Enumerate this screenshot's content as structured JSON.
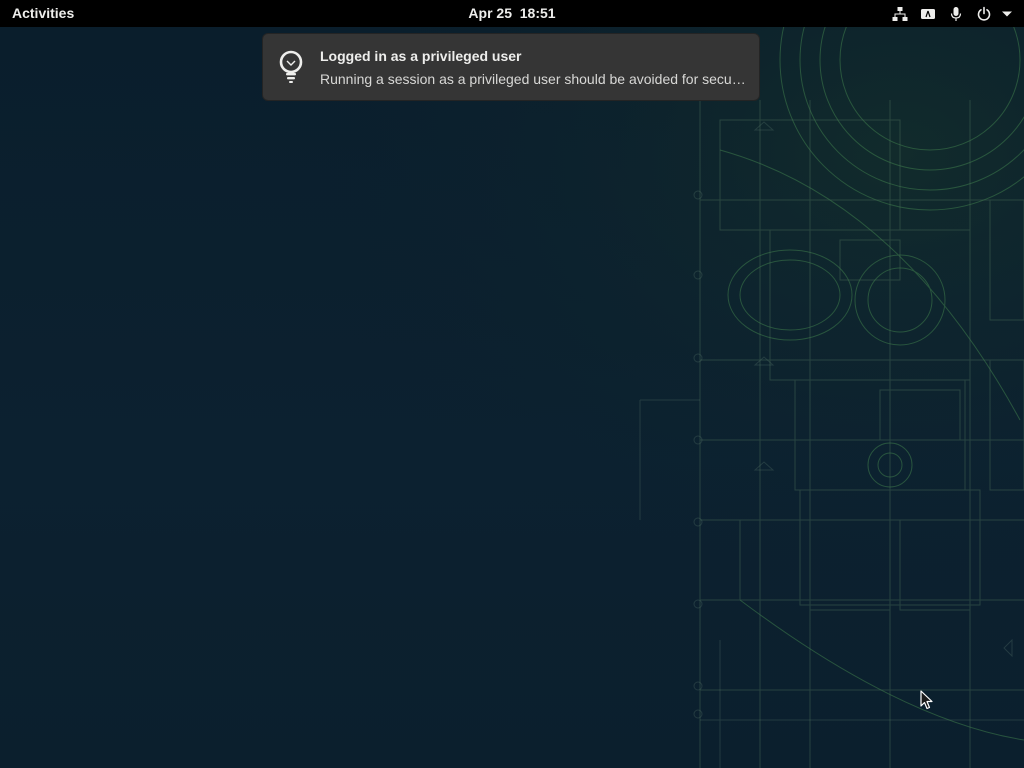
{
  "topbar": {
    "activities_label": "Activities",
    "clock": "Apr 25  18:51",
    "tray_icons": [
      "network-icon",
      "keyboard-layout-icon",
      "microphone-icon",
      "power-icon",
      "chevron-down-icon"
    ]
  },
  "notification": {
    "icon": "lightbulb-icon",
    "title": "Logged in as a privileged user",
    "body": "Running a session as a privileged user should be avoided for security reasons."
  },
  "colors": {
    "topbar": "#000000",
    "desktop": "#0b1f2d",
    "notification_bg": "#353535",
    "wallpaper_lines": "#3d7a4a"
  }
}
